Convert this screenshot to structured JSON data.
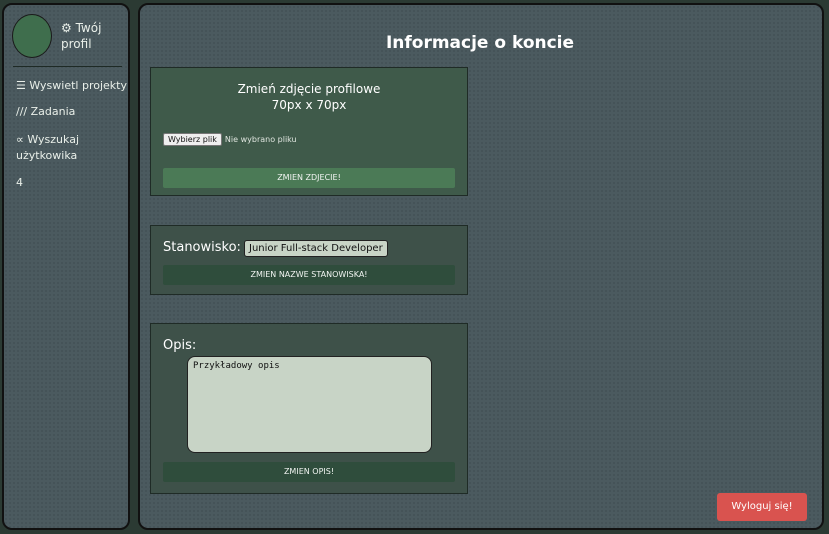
{
  "sidebar": {
    "profile_label": "⚙ Twój profil",
    "items": [
      {
        "label": "☰ Wyswietl projekty"
      },
      {
        "label": "/// Zadania"
      },
      {
        "label": "∝ Wyszukaj użytkowika"
      },
      {
        "label": "4"
      }
    ]
  },
  "main": {
    "title": "Informacje o koncie",
    "photo": {
      "heading_line1": "Zmień zdjęcie profilowe",
      "heading_line2": "70px x 70px",
      "file_button": "Wybierz plik",
      "file_status": "Nie wybrano pliku",
      "submit": "ZMIEN ZDJECIE!"
    },
    "position": {
      "label": "Stanowisko:",
      "value": "Junior Full-stack Developer",
      "submit": "ZMIEN NAZWE STANOWISKA!"
    },
    "description": {
      "label": "Opis:",
      "value": "Przykładowy opis",
      "submit": "ZMIEN OPIS!"
    },
    "logout": "Wyloguj się!"
  },
  "colors": {
    "background": "#2b3a33",
    "panel": "#4b5a5f",
    "accent_green": "#4b7a56",
    "dark_green": "#2f4d3c",
    "logout_red": "#d9534f",
    "field_bg": "#c8d4c6"
  }
}
